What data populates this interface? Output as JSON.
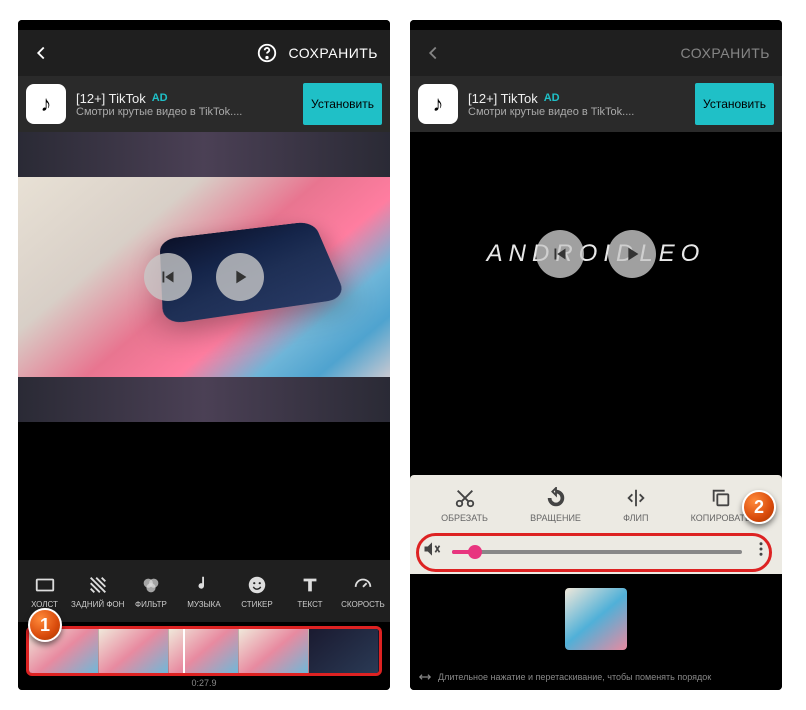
{
  "topbar": {
    "save": "СОХРАНИТЬ"
  },
  "ad": {
    "title": "[12+] TikTok",
    "badge": "AD",
    "sub": "Смотри крутые видео в TikTok....",
    "install": "Установить"
  },
  "tools": [
    {
      "label": "ХОЛСТ"
    },
    {
      "label": "ЗАДНИЙ ФОН"
    },
    {
      "label": "ФИЛЬТР"
    },
    {
      "label": "МУЗЫКА"
    },
    {
      "label": "СТИКЕР"
    },
    {
      "label": "ТЕКСТ"
    },
    {
      "label": "СКОРОСТЬ"
    }
  ],
  "edit": {
    "cut": "ОБРЕЗАТЬ",
    "rotate": "ВРАЩЕНИЕ",
    "flip": "ФЛИП",
    "copy": "КОПИРОВАТЬ"
  },
  "timeline": {
    "time": "0:27.9"
  },
  "preview2_text": "ANDROIDLEO",
  "hint": "Длительное нажатие и перетаскивание, чтобы поменять порядок",
  "badges": {
    "one": "1",
    "two": "2"
  },
  "volume_pct": 8
}
